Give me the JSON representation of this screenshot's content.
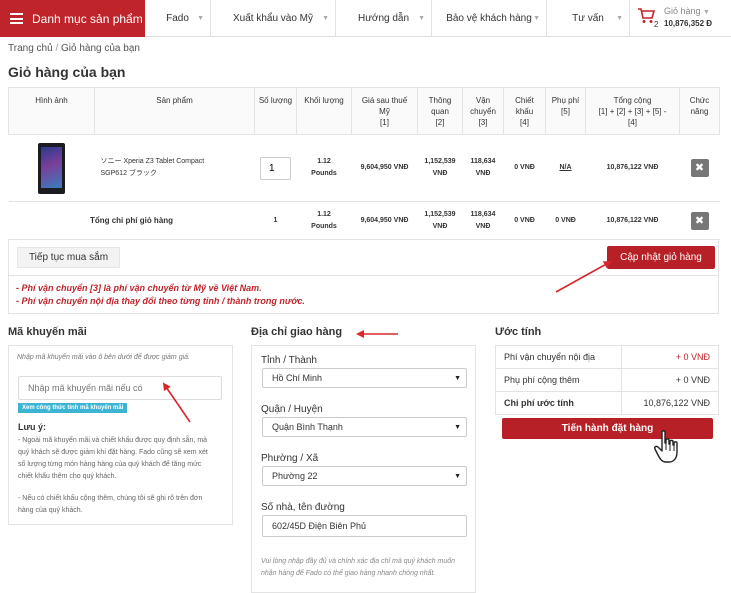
{
  "nav": {
    "category_label": "Danh mục sản phẩm",
    "items": [
      "Fado",
      "Xuất khẩu vào Mỹ",
      "Hướng dẫn",
      "Bảo vệ khách hàng",
      "Tư vấn"
    ],
    "cart_label": "Giỏ hàng",
    "cart_count": "2",
    "cart_amount": "10,876,352 Đ"
  },
  "breadcrumb": {
    "home": "Trang chủ",
    "sep": "/",
    "current": "Giỏ hàng của bạn"
  },
  "page_title": "Giỏ hàng của bạn",
  "table": {
    "headers": {
      "image": "Hình ảnh",
      "product": "Sản phẩm",
      "qty": "Số lượng",
      "weight": "Khối lượng",
      "price_l1": "Giá sau thuế",
      "price_l2": "Mỹ",
      "price_l3": "[1]",
      "customs_l1": "Thông",
      "customs_l2": "quan",
      "customs_l3": "[2]",
      "ship_l1": "Vận",
      "ship_l2": "chuyển",
      "ship_l3": "[3]",
      "disc_l1": "Chiết",
      "disc_l2": "khấu",
      "disc_l3": "[4]",
      "fee_l1": "Phụ phí",
      "fee_l2": "[5]",
      "total_l1": "Tổng cộng",
      "total_l2": "[1] + [2] + [3] + [5] -",
      "total_l3": "[4]",
      "func_l1": "Chức",
      "func_l2": "năng"
    },
    "item": {
      "name_l1": "ソニー Xperia Z3 Tablet Compact",
      "name_l2": "SGP612 ブラック",
      "qty": "1",
      "weight_l1": "1.12",
      "weight_l2": "Pounds",
      "price": "9,604,950 VNĐ",
      "customs_l1": "1,152,539",
      "customs_l2": "VNĐ",
      "ship_l1": "118,634",
      "ship_l2": "VNĐ",
      "discount": "0 VNĐ",
      "fee": "N/A",
      "total": "10,876,122 VNĐ",
      "delete": "✖"
    },
    "totals": {
      "label": "Tổng chi phí giỏ hàng",
      "qty": "1",
      "weight_l1": "1.12",
      "weight_l2": "Pounds",
      "price": "9,604,950 VNĐ",
      "customs_l1": "1,152,539",
      "customs_l2": "VNĐ",
      "ship_l1": "118,634",
      "ship_l2": "VNĐ",
      "discount": "0 VNĐ",
      "fee": "0 VNĐ",
      "total": "10,876,122 VNĐ",
      "delete": "✖"
    }
  },
  "actions": {
    "continue": "Tiếp tục mua sắm",
    "update": "Cập nhật giỏ hàng"
  },
  "notes": [
    "- Phí vận chuyển [3] là phí vận chuyển từ Mỹ về Việt Nam.",
    "- Phí vận chuyển nội địa thay đổi theo từng tỉnh / thành trong nước."
  ],
  "promo": {
    "title": "Mã khuyến mãi",
    "hint": "Nhập mã khuyến mãi vào ô bên dưới để được giảm giá.",
    "placeholder": "Nhập mã khuyến mãi nếu có",
    "formula_link": "Xem công thức tính mã khuyến mãi",
    "note_label": "Lưu ý:",
    "note1_lines": [
      "- Ngoài mã khuyến mãi và chiết khấu được quy định sẵn, mà",
      "quý khách sẽ được giảm khi đặt hàng. Fado cũng sẽ xem xét",
      "số lượng từng món hàng hàng của quý khách để tăng mức",
      "chiết khấu thêm cho quý khách."
    ],
    "note2_lines": [
      "- Nếu có chiết khấu cộng thêm, chúng tôi sẽ ghi rõ trên đơn",
      "hàng của quý khách."
    ]
  },
  "address": {
    "title": "Địa chỉ giao hàng",
    "province_label": "Tỉnh / Thành",
    "province_value": "Hồ Chí Minh",
    "district_label": "Quận / Huyện",
    "district_value": "Quận Bình Thạnh",
    "ward_label": "Phường / Xã",
    "ward_value": "Phường 22",
    "street_label": "Số nhà, tên đường",
    "street_value": "602/45D Điện Biên Phủ",
    "hint_l1": "Vui lòng nhập đầy đủ và chính xác địa chỉ mà quý khách muốn",
    "hint_l2": "nhận hàng để Fado có thể giao hàng nhanh chóng nhất."
  },
  "estimate": {
    "title": "Ước tính",
    "rows": [
      {
        "label": "Phí vận chuyển nội địa",
        "value": "+ 0 VNĐ"
      },
      {
        "label": "Phụ phí cộng thêm",
        "value": "+ 0 VNĐ"
      },
      {
        "label": "Chi phí ước tính",
        "value": "10,876,122 VNĐ"
      }
    ],
    "checkout": "Tiến hành đặt hàng"
  },
  "colors": {
    "brand_red": "#c0242b",
    "button_red": "#b82028",
    "link_blue": "#3db4d4",
    "annotation_arrow": "#d8262b"
  },
  "icons": [
    "hamburger-icon",
    "cart-icon",
    "caret-down-icon",
    "close-icon",
    "select-arrow-icon",
    "hand-cursor-icon",
    "annotation-arrow"
  ]
}
